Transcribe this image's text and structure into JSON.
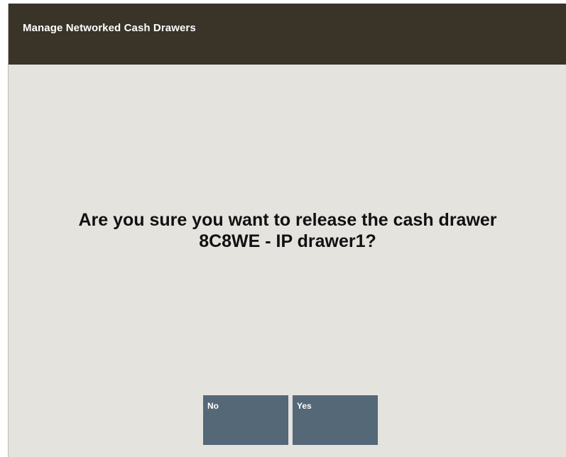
{
  "window": {
    "title": "Manage Networked Cash Drawers"
  },
  "dialog": {
    "message_line1": "Are you sure you want to release the cash drawer",
    "message_line2": "8C8WE - IP drawer1?"
  },
  "buttons": {
    "no_label": "No",
    "yes_label": "Yes"
  },
  "colors": {
    "title_bar": "#3a3328",
    "background": "#e5e3de",
    "button": "#546878"
  }
}
